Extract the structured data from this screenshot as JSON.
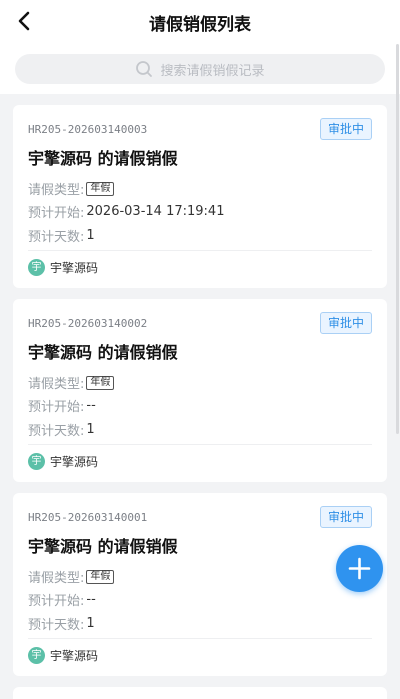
{
  "header": {
    "title": "请假销假列表",
    "back_icon": "chevron-left-icon"
  },
  "search": {
    "placeholder": "搜索请假销假记录"
  },
  "cards": [
    {
      "code": "HR205-202603140003",
      "status": "审批中",
      "title": "宇擎源码 的请假销假",
      "leave_type_label": "请假类型:",
      "leave_type": "年假",
      "start_label": "预计开始:",
      "start": "2026-03-14 17:19:41",
      "days_label": "预计天数:",
      "days": "1",
      "user_initial": "宇",
      "user_name": "宇擎源码"
    },
    {
      "code": "HR205-202603140002",
      "status": "审批中",
      "title": "宇擎源码 的请假销假",
      "leave_type_label": "请假类型:",
      "leave_type": "年假",
      "start_label": "预计开始:",
      "start": "--",
      "days_label": "预计天数:",
      "days": "1",
      "user_initial": "宇",
      "user_name": "宇擎源码"
    },
    {
      "code": "HR205-202603140001",
      "status": "审批中",
      "title": "宇擎源码 的请假销假",
      "leave_type_label": "请假类型:",
      "leave_type": "年假",
      "start_label": "预计开始:",
      "start": "--",
      "days_label": "预计天数:",
      "days": "1",
      "user_initial": "宇",
      "user_name": "宇擎源码"
    }
  ],
  "colors": {
    "accent": "#2f93ef",
    "badge_text": "#2f8fe6",
    "avatar": "#5cc0a8"
  }
}
